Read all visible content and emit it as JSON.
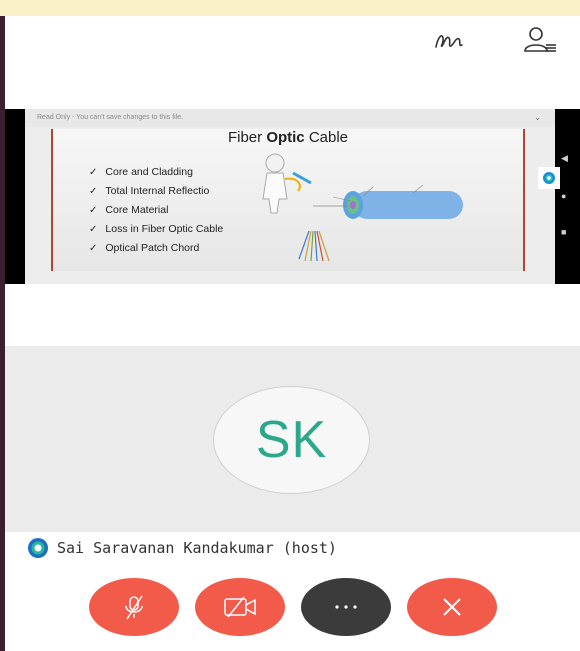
{
  "share": {
    "header": "Read Only - You can't save changes to this file.",
    "slide_title_prefix": "Fiber ",
    "slide_title_bold": "Optic",
    "slide_title_suffix": " Cable",
    "bullets": [
      "Core and Cladding",
      "Total Internal Reflectio",
      "Core Material",
      "Loss in Fiber Optic Cable",
      "Optical Patch Chord"
    ]
  },
  "participant": {
    "initials": "SK",
    "name": "Sai Saravanan Kandakumar (host)"
  },
  "colors": {
    "accent": "#2aa889",
    "end_red": "#f25a4a",
    "more_dark": "#3b3b3b"
  }
}
